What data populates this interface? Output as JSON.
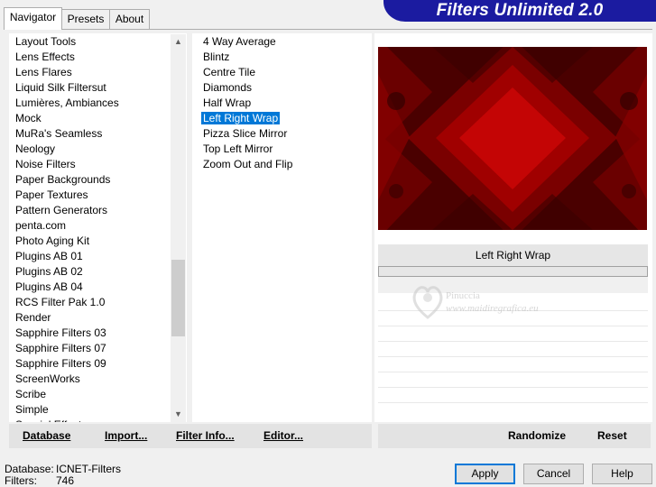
{
  "tabs": [
    {
      "label": "Navigator",
      "active": true
    },
    {
      "label": "Presets",
      "active": false
    },
    {
      "label": "About",
      "active": false
    }
  ],
  "banner": {
    "title": "Filters Unlimited 2.0"
  },
  "categories": [
    "Layout Tools",
    "Lens Effects",
    "Lens Flares",
    "Liquid Silk Filtersut",
    "Lumières, Ambiances",
    "Mock",
    "MuRa's Seamless",
    "Neology",
    "Noise Filters",
    "Paper Backgrounds",
    "Paper Textures",
    "Pattern Generators",
    "penta.com",
    "Photo Aging Kit",
    "Plugins AB 01",
    "Plugins AB 02",
    "Plugins AB 04",
    "RCS Filter Pak 1.0",
    "Render",
    "Sapphire Filters 03",
    "Sapphire Filters 07",
    "Sapphire Filters 09",
    "ScreenWorks",
    "Scribe",
    "Simple",
    "Special Effects"
  ],
  "filters": {
    "items": [
      "4 Way Average",
      "Blintz",
      "Centre Tile",
      "Diamonds",
      "Half Wrap",
      "Left Right Wrap",
      "Pizza Slice Mirror",
      "Top Left Mirror",
      "Zoom Out and Flip"
    ],
    "selected_index": 5
  },
  "toolbar": {
    "database": "Database",
    "import": "Import...",
    "filter_info": "Filter Info...",
    "editor": "Editor...",
    "randomize": "Randomize",
    "reset": "Reset"
  },
  "preview": {
    "filter_name": "Left Right Wrap",
    "progress": 0,
    "colors": {
      "dark": "#4a0000",
      "mid": "#8a0000",
      "bright": "#b80000"
    }
  },
  "watermark": {
    "line1": "Pinuccia",
    "line2": "www.maidiregrafica.eu"
  },
  "status": {
    "database_label": "Database:",
    "database_value": "ICNET-Filters",
    "filters_label": "Filters:",
    "filters_value": "746"
  },
  "buttons": {
    "apply": "Apply",
    "cancel": "Cancel",
    "help": "Help"
  }
}
